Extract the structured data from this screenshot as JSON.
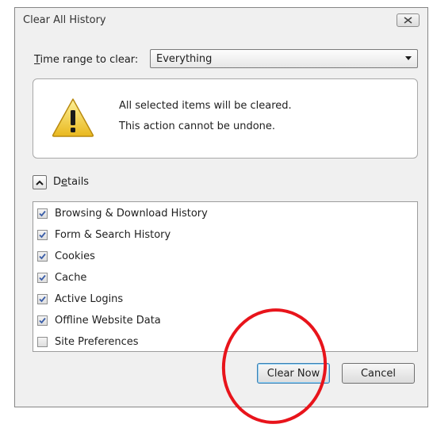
{
  "window": {
    "title": "Clear All History"
  },
  "time_range": {
    "label": "Time range to clear:",
    "selected": "Everything"
  },
  "warning": {
    "line1": "All selected items will be cleared.",
    "line2": "This action cannot be undone."
  },
  "details": {
    "label_first": "D",
    "label_u": "e",
    "label_rest": "tails",
    "expanded": true
  },
  "items": [
    {
      "label": "Browsing & Download History",
      "checked": true
    },
    {
      "label": "Form & Search History",
      "checked": true
    },
    {
      "label": "Cookies",
      "checked": true
    },
    {
      "label": "Cache",
      "checked": true
    },
    {
      "label": "Active Logins",
      "checked": true
    },
    {
      "label": "Offline Website Data",
      "checked": true
    },
    {
      "label": "Site Preferences",
      "checked": false
    }
  ],
  "buttons": {
    "clear_now": "Clear Now",
    "cancel": "Cancel"
  },
  "colors": {
    "annotation": "#e8141b",
    "check": "#3b5ea8",
    "warning_fill": "#f7d54a"
  },
  "icons": {
    "close": "close-icon",
    "warning": "warning-icon",
    "collapse": "chevron-up-icon",
    "dropdown": "chevron-down-icon",
    "check": "checkmark-icon"
  }
}
